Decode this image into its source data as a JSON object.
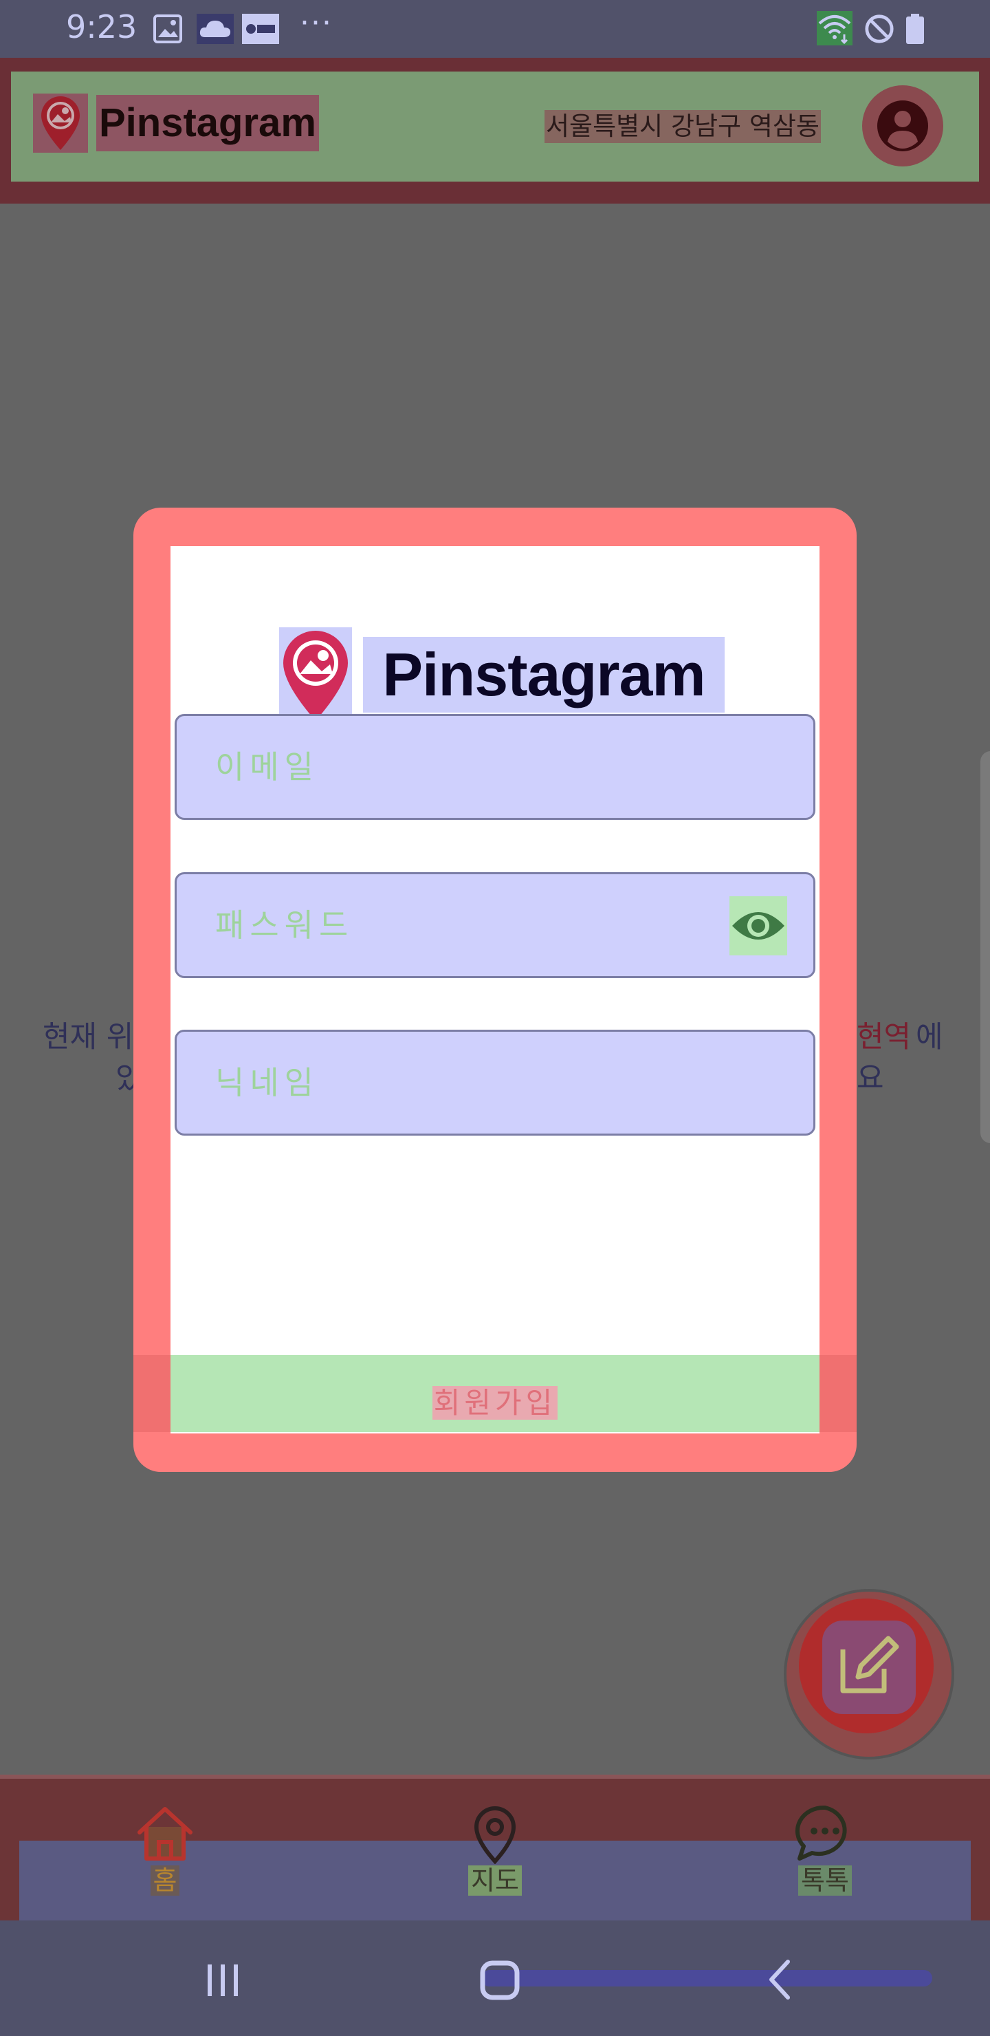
{
  "status_bar": {
    "time": "9:23",
    "left_icons": [
      "image-icon",
      "cloud-icon",
      "app-badge-icon"
    ],
    "overflow": "···",
    "right_icons": [
      "wifi-icon",
      "do-not-disturb-icon",
      "battery-icon"
    ]
  },
  "app_bar": {
    "title": "Pinstagram",
    "location": "서울특별시 강남구 역삼동",
    "avatar_icon": "account-circle-icon"
  },
  "background_notice": {
    "line1_left": "현재 위",
    "line1_right_a": "현역",
    "line1_right_b": "에",
    "line2_left": "있",
    "line2_right": "요"
  },
  "signup_modal": {
    "logo_text": "Pinstagram",
    "email_placeholder": "이메일",
    "password_placeholder": "패스워드",
    "nickname_placeholder": "닉네임",
    "submit_label": "회원가입"
  },
  "bottom_nav": {
    "items": [
      {
        "label": "홈",
        "icon": "home-icon"
      },
      {
        "label": "지도",
        "icon": "map-pin-icon"
      },
      {
        "label": "톡톡",
        "icon": "chat-icon"
      }
    ]
  },
  "colors": {
    "modal_frame": "#ff7e7e",
    "field_fill": "#cfd0fd",
    "brand_pink": "#d12c5a",
    "brand_dark": "#0b0726"
  }
}
